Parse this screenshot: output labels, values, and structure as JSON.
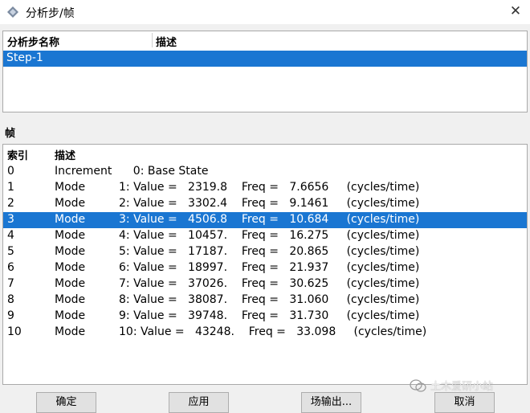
{
  "window": {
    "title": "分析步/帧",
    "close_glyph": "✕"
  },
  "steps_table": {
    "headers": [
      "分析步名称",
      "描述"
    ],
    "rows": [
      {
        "name": "Step-1",
        "description": ""
      }
    ],
    "selected_index": 0
  },
  "frames_section": {
    "label": "帧"
  },
  "frames_table": {
    "headers": [
      "索引",
      "描述"
    ],
    "rows": [
      {
        "index": "0",
        "type": "Increment",
        "text": "    0: Base State"
      },
      {
        "index": "1",
        "type": "Mode",
        "text": "1: Value =   2319.8    Freq =   7.6656     (cycles/time)"
      },
      {
        "index": "2",
        "type": "Mode",
        "text": "2: Value =   3302.4    Freq =   9.1461     (cycles/time)"
      },
      {
        "index": "3",
        "type": "Mode",
        "text": "3: Value =   4506.8    Freq =   10.684     (cycles/time)"
      },
      {
        "index": "4",
        "type": "Mode",
        "text": "4: Value =   10457.    Freq =   16.275     (cycles/time)"
      },
      {
        "index": "5",
        "type": "Mode",
        "text": "5: Value =   17187.    Freq =   20.865     (cycles/time)"
      },
      {
        "index": "6",
        "type": "Mode",
        "text": "6: Value =   18997.    Freq =   21.937     (cycles/time)"
      },
      {
        "index": "7",
        "type": "Mode",
        "text": "7: Value =   37026.    Freq =   30.625     (cycles/time)"
      },
      {
        "index": "8",
        "type": "Mode",
        "text": "8: Value =   38087.    Freq =   31.060     (cycles/time)"
      },
      {
        "index": "9",
        "type": "Mode",
        "text": "9: Value =   39748.    Freq =   31.730     (cycles/time)"
      },
      {
        "index": "10",
        "type": "Mode",
        "text": "10: Value =   43248.    Freq =   33.098     (cycles/time)"
      }
    ],
    "selected_index": 3
  },
  "buttons": {
    "ok": "确定",
    "apply": "应用",
    "field_output": "场输出...",
    "cancel": "取消"
  },
  "watermark": {
    "text": "土木爱研小站",
    "icon": "wechat-icon"
  },
  "colors": {
    "selection": "#1a76d2",
    "panel_bg": "#ffffff",
    "window_bg": "#f0f0f0"
  }
}
